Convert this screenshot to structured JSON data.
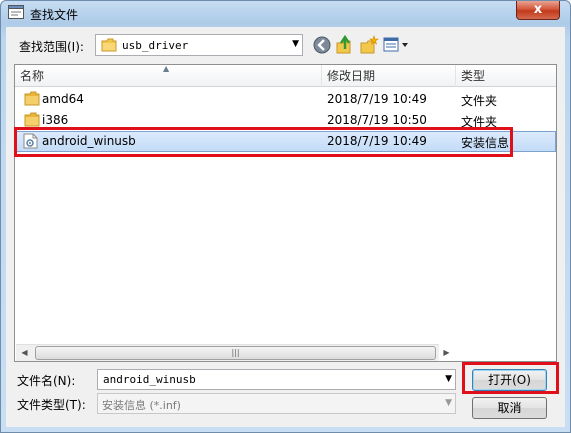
{
  "window": {
    "title": "查找文件",
    "close_label": "x"
  },
  "toolbar": {
    "look_in_label": "查找范围(I):",
    "look_in_value": "usb_driver",
    "icons": [
      "back-icon",
      "up-folder-icon",
      "new-folder-icon",
      "view-menu-icon"
    ]
  },
  "list": {
    "columns": [
      "名称",
      "修改日期",
      "类型"
    ],
    "rows": [
      {
        "name": "amd64",
        "date": "2018/7/19 10:49",
        "type": "文件夹",
        "icon": "folder-icon"
      },
      {
        "name": "i386",
        "date": "2018/7/19 10:50",
        "type": "文件夹",
        "icon": "folder-icon"
      },
      {
        "name": "android_winusb",
        "date": "2018/7/19 10:49",
        "type": "安装信息",
        "icon": "inf-file-icon",
        "selected": true
      }
    ]
  },
  "footer": {
    "filename_label": "文件名(N):",
    "filename_value": "android_winusb",
    "filetype_label": "文件类型(T):",
    "filetype_value": "安装信息 (*.inf)",
    "open_label": "打开(O)",
    "cancel_label": "取消"
  },
  "colors": {
    "highlight": "#e0101a",
    "selection": "#c3dcf8",
    "accent": "#3c7fb1"
  }
}
